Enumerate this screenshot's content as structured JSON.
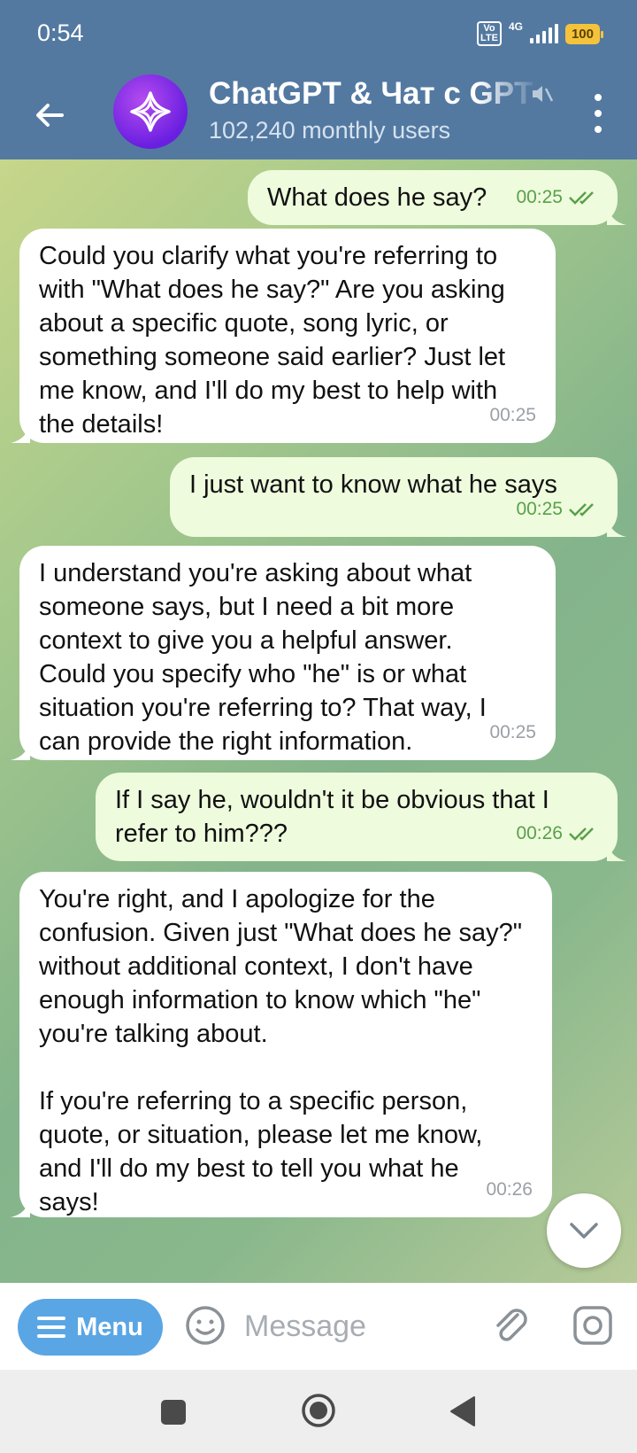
{
  "status": {
    "time": "0:54",
    "volte": "Vo LTE",
    "network": "4G",
    "battery": "100"
  },
  "header": {
    "title": "ChatGPT & Чат с GPT",
    "subtitle": "102,240 monthly users",
    "avatar_icon": "ai-sparkle-icon"
  },
  "messages": [
    {
      "dir": "out",
      "text": "What does he say?",
      "time": "00:25",
      "status": "read"
    },
    {
      "dir": "in",
      "text": "Could you clarify what you're referring to with \"What does he say?\" Are you asking about a specific quote, song lyric, or something someone said earlier? Just let me know, and I'll do my best to help with the details!",
      "time": "00:25"
    },
    {
      "dir": "out",
      "text": "I just want to know what he says",
      "time": "00:25",
      "status": "read"
    },
    {
      "dir": "in",
      "text": "I understand you're asking about what someone says, but I need a bit more context to give you a helpful answer. Could you specify who \"he\" is or what situation you're referring to? That way, I can provide the right information.",
      "time": "00:25"
    },
    {
      "dir": "out",
      "text": "If I say he, wouldn't it be obvious that I refer to him???",
      "time": "00:26",
      "status": "read"
    },
    {
      "dir": "in",
      "text": "You're right, and I apologize for the confusion. Given just \"What does he say?\" without additional context, I don't have enough information to know which \"he\" you're talking about.\n\nIf you're referring to a specific person, quote, or situation, please let me know, and I'll do my best to tell you what he says!",
      "time": "00:26"
    }
  ],
  "input": {
    "menu_label": "Menu",
    "placeholder": "Message"
  },
  "colors": {
    "header": "#5379a1",
    "outgoing_bubble": "#eefbdd",
    "incoming_bubble": "#ffffff",
    "read_check": "#5aa04a",
    "menu_button": "#5aa6e4"
  }
}
